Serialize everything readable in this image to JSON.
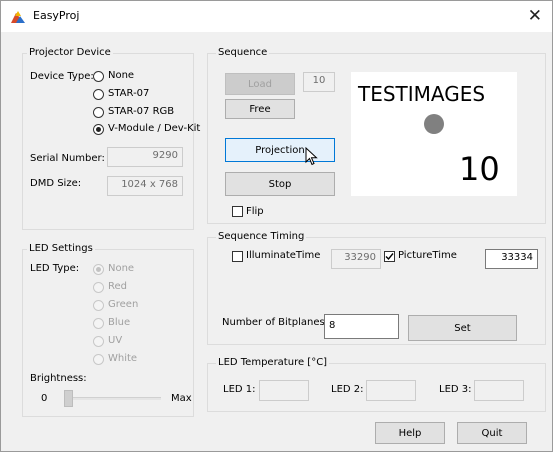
{
  "window": {
    "title": "EasyProj",
    "close_label": "✕"
  },
  "projector": {
    "group_title": "Projector Device",
    "device_type_label": "Device Type:",
    "options": [
      "None",
      "STAR-07",
      "STAR-07 RGB",
      "V-Module / Dev-Kit"
    ],
    "selected_index": 3,
    "serial_label": "Serial Number:",
    "serial_value": "9290",
    "dmd_label": "DMD Size:",
    "dmd_value": "1024 x 768"
  },
  "led_settings": {
    "group_title": "LED Settings",
    "type_label": "LED Type:",
    "options": [
      "None",
      "Red",
      "Green",
      "Blue",
      "UV",
      "White"
    ],
    "selected_index": 0,
    "brightness_label": "Brightness:",
    "min_label": "0",
    "max_label": "Max",
    "brightness_level": 0
  },
  "sequence": {
    "group_title": "Sequence",
    "load_label": "Load",
    "load_count": "10",
    "free_label": "Free",
    "projection_label": "Projection",
    "stop_label": "Stop",
    "flip_label": "Flip",
    "flip_checked": false,
    "preview_title": "TESTIMAGES",
    "preview_number": "10"
  },
  "timing": {
    "group_title": "Sequence Timing",
    "illuminate_label": "IlluminateTime",
    "illuminate_checked": false,
    "illuminate_value": "33290",
    "picture_label": "PictureTime",
    "picture_checked": true,
    "picture_value": "33334",
    "bitplanes_label": "Number of Bitplanes:",
    "bitplanes_value": "8",
    "set_label": "Set"
  },
  "led_temp": {
    "group_title": "LED Temperature [°C]",
    "led1_label": "LED 1:",
    "led2_label": "LED 2:",
    "led3_label": "LED 3:"
  },
  "footer": {
    "help_label": "Help",
    "quit_label": "Quit"
  },
  "colors": {
    "focus_border": "#0078d7",
    "preview_dot": "#808080"
  }
}
